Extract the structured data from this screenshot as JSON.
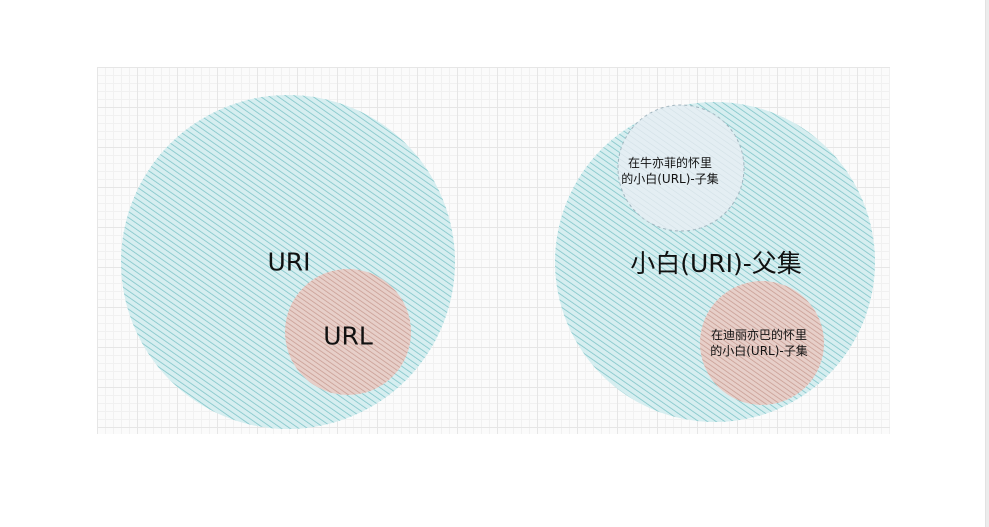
{
  "colors": {
    "parent_hatch": "#7fc4c8",
    "parent_fill": "#d6eef0",
    "child_hatch": "#c9a39a",
    "child_fill": "#e7cfc9",
    "dashed_fill": "#e4eef3",
    "dashed_stroke": "#9fb3bd"
  },
  "left_diagram": {
    "outer_label": "URI",
    "inner_label": "URL"
  },
  "right_diagram": {
    "outer_label": "小白(URI)-父集",
    "subset_top": {
      "line1": "在牛亦菲的怀里",
      "line2": "的小白(URL)-子集"
    },
    "subset_bottom": {
      "line1": "在迪丽亦巴的怀里",
      "line2": "的小白(URL)-子集"
    }
  }
}
